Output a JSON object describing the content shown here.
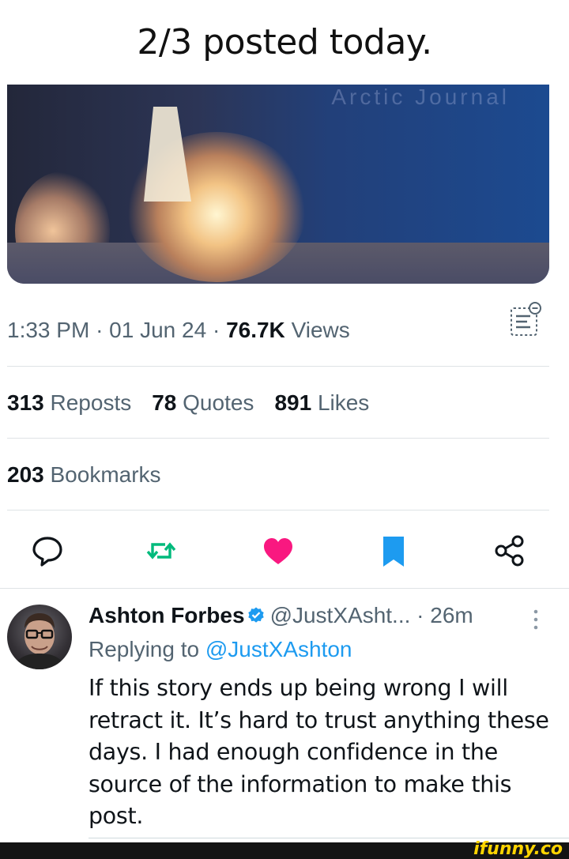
{
  "caption": "2/3 posted today.",
  "post": {
    "time": "1:33 PM",
    "date": "01 Jun 24",
    "views_count": "76.7K",
    "views_label": "Views",
    "reposts_count": "313",
    "reposts_label": "Reposts",
    "quotes_count": "78",
    "quotes_label": "Quotes",
    "likes_count": "891",
    "likes_label": "Likes",
    "bookmarks_count": "203",
    "bookmarks_label": "Bookmarks",
    "media_watermark": "Arctic Journal"
  },
  "actions": {
    "icons": [
      "reply-icon",
      "repost-icon",
      "like-icon",
      "bookmark-icon",
      "share-icon"
    ],
    "repost_color": "#00ba7c",
    "like_color": "#f91880",
    "bookmark_color": "#1d9bf0"
  },
  "reply": {
    "display_name": "Ashton Forbes",
    "handle": "@JustXAsht...",
    "time_ago": "26m",
    "replying_to_label": "Replying to",
    "replying_to_handle": "@JustXAshton",
    "text": "If this story ends up being wrong I will retract it. It’s hard to trust anything these days. I had enough confidence in the source of the information to make this post."
  },
  "footer": {
    "brand": "ifunny.co"
  },
  "colors": {
    "text_primary": "#0f1419",
    "text_secondary": "#536471",
    "link": "#1d9bf0",
    "footer_bg": "#141414",
    "brand_yellow": "#ffd400"
  }
}
